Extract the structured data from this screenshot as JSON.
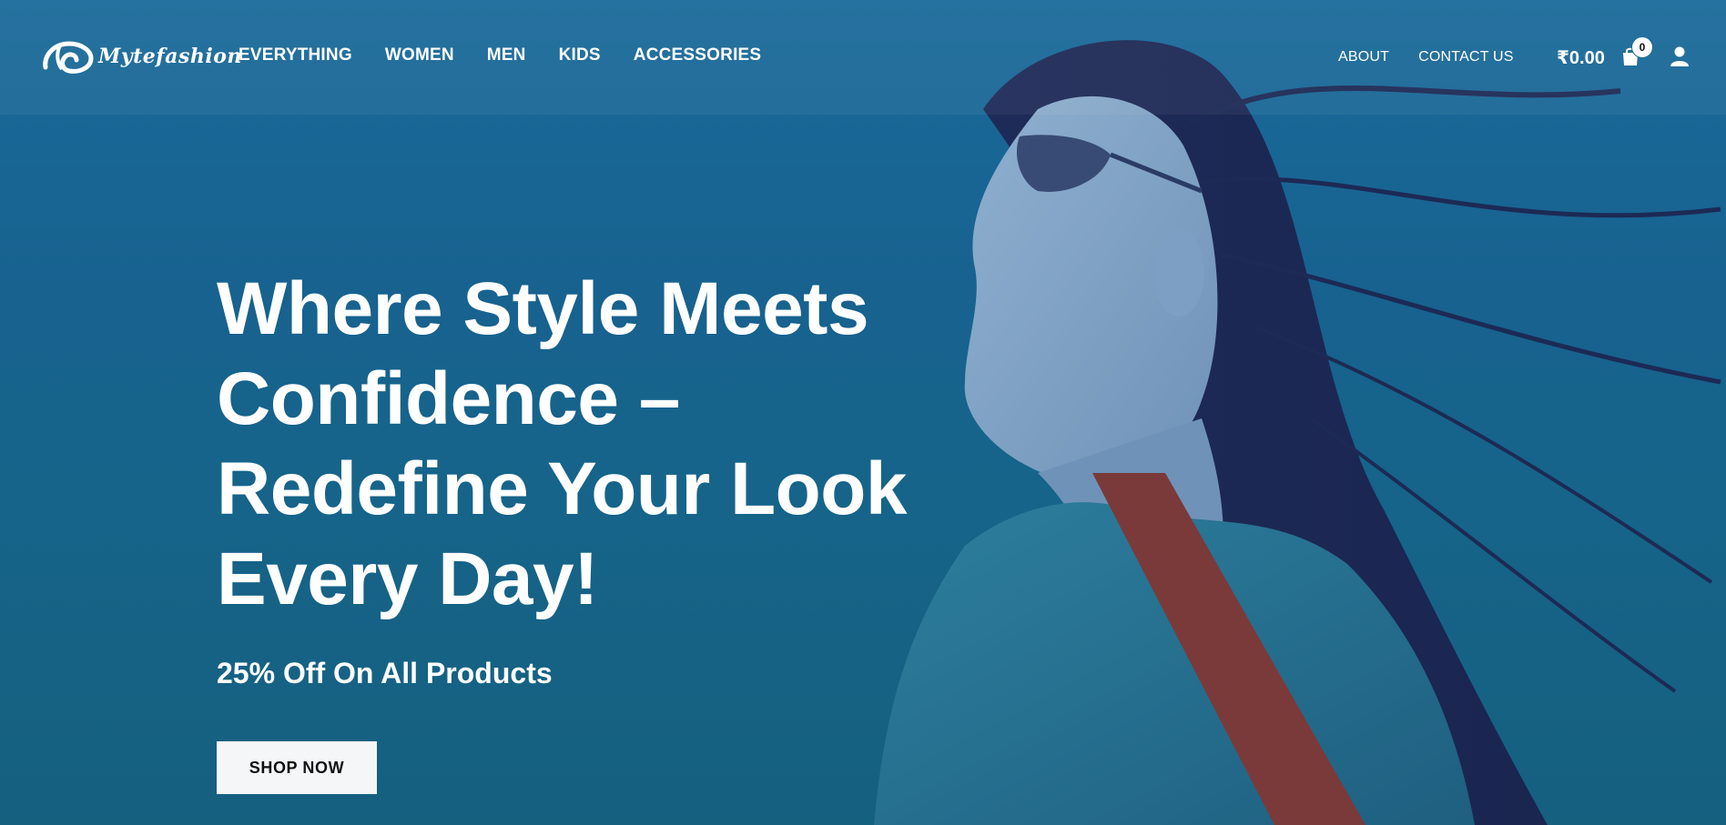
{
  "brand": {
    "name": "Mytefashion",
    "logo_icon": "brand-mark-icon"
  },
  "nav": {
    "main": [
      {
        "label": "EVERYTHING"
      },
      {
        "label": "WOMEN"
      },
      {
        "label": "MEN"
      },
      {
        "label": "KIDS"
      },
      {
        "label": "ACCESSORIES"
      }
    ],
    "secondary": [
      {
        "label": "ABOUT"
      },
      {
        "label": "CONTACT US"
      }
    ]
  },
  "cart": {
    "total": "₹0.00",
    "count": "0",
    "icon": "shopping-bag-icon"
  },
  "account": {
    "icon": "user-icon"
  },
  "hero": {
    "headline": "Where Style Meets Confidence – Redefine Your Look Every Day!",
    "subhead": "25% Off On All Products",
    "cta_label": "SHOP NOW"
  },
  "colors": {
    "overlay": "#17628f",
    "text": "#ffffff",
    "button_bg": "#f5f6f8",
    "button_text": "#111111"
  }
}
